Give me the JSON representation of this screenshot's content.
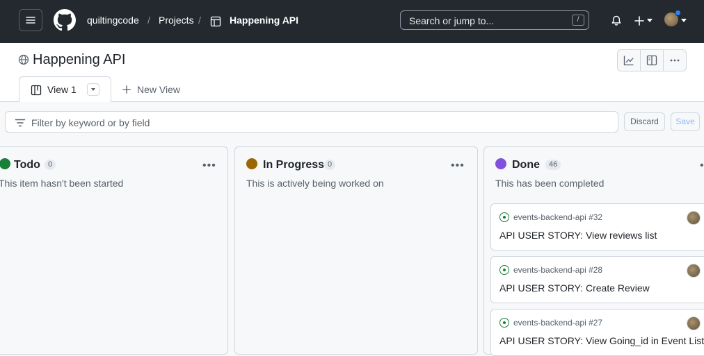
{
  "nav": {
    "org": "quiltingcode",
    "projects": "Projects",
    "project": "Happening API",
    "search_placeholder": "Search or jump to...",
    "search_shortcut": "/"
  },
  "header": {
    "title": "Happening API",
    "tab_label": "View 1",
    "new_view": "New View"
  },
  "filter": {
    "placeholder": "Filter by keyword or by field",
    "discard": "Discard",
    "save": "Save"
  },
  "columns": [
    {
      "title": "Todo",
      "count": "0",
      "desc": "This item hasn't been started",
      "color": "#1a7f37"
    },
    {
      "title": "In Progress",
      "count": "0",
      "desc": "This is actively being worked on",
      "color": "#9a6700"
    },
    {
      "title": "Done",
      "count": "46",
      "desc": "This has been completed",
      "color": "#8250df"
    }
  ],
  "cards": [
    {
      "repo": "events-backend-api #32",
      "title": "API USER STORY: View reviews list"
    },
    {
      "repo": "events-backend-api #28",
      "title": "API USER STORY: Create Review"
    },
    {
      "repo": "events-backend-api #27",
      "title": "API USER STORY: View Going_id in Event List"
    }
  ],
  "icons": {
    "menu": "hamburger-menu-icon",
    "logo": "github-logo-icon",
    "table": "table-icon",
    "bell": "bell-icon",
    "plus": "plus-icon",
    "globe": "globe-icon",
    "insights": "graph-icon",
    "layout": "sidebar-layout-icon",
    "more": "kebab-horizontal-icon",
    "board": "project-board-icon",
    "filter": "filter-icon",
    "issue": "issue-open-icon"
  }
}
